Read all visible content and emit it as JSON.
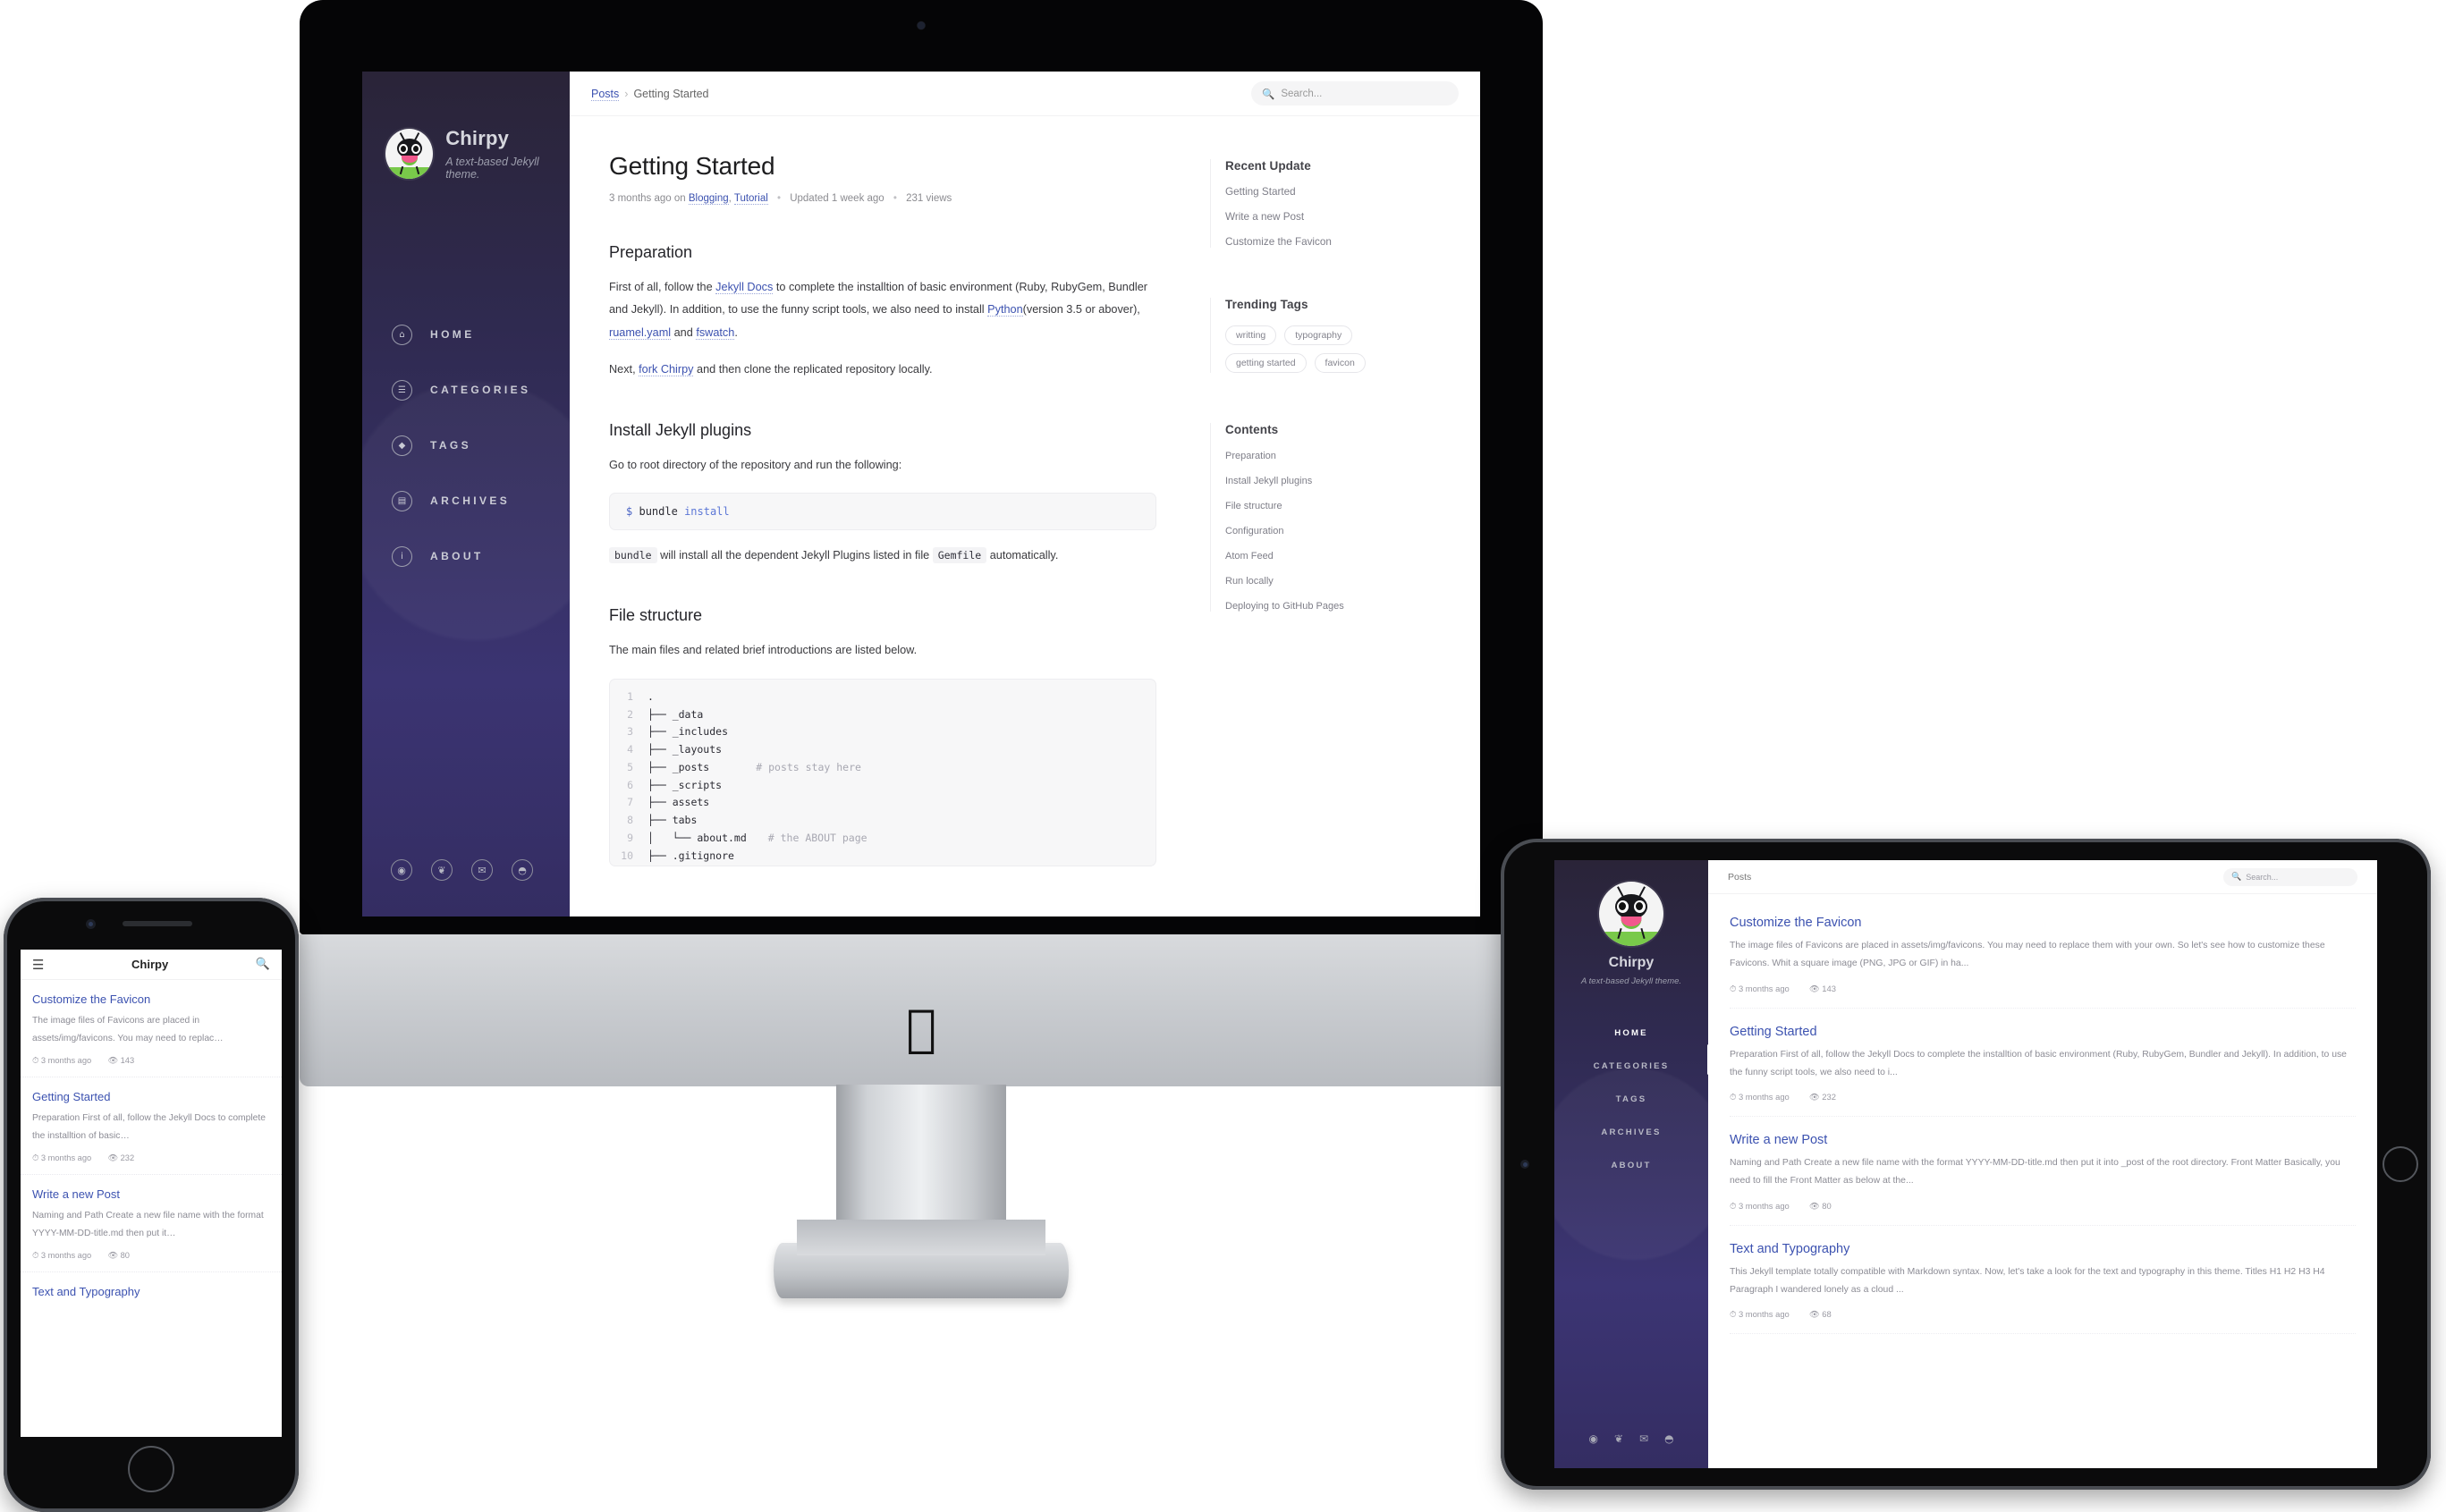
{
  "brand": {
    "name": "Chirpy",
    "tagline": "A text-based Jekyll theme.",
    "accent": "#3c52b0",
    "sidebar_color": "#332c62"
  },
  "desktop": {
    "breadcrumb": {
      "root": "Posts",
      "separator": "›",
      "current": "Getting Started"
    },
    "search": {
      "placeholder": "Search...",
      "icon": "search-icon"
    },
    "nav": [
      {
        "label": "HOME",
        "icon": "home-icon",
        "glyph": "⌂"
      },
      {
        "label": "CATEGORIES",
        "icon": "stream-icon",
        "glyph": "☰"
      },
      {
        "label": "TAGS",
        "icon": "tag-icon",
        "glyph": "◆"
      },
      {
        "label": "ARCHIVES",
        "icon": "archive-icon",
        "glyph": "▤"
      },
      {
        "label": "ABOUT",
        "icon": "info-icon",
        "glyph": "i"
      }
    ],
    "social": [
      {
        "name": "github-icon",
        "glyph": "●"
      },
      {
        "name": "twitter-icon",
        "glyph": "❦"
      },
      {
        "name": "email-icon",
        "glyph": "✉"
      },
      {
        "name": "rss-icon",
        "glyph": "◔"
      }
    ],
    "post": {
      "title": "Getting Started",
      "meta": {
        "published": "3 months ago on",
        "categories": [
          "Blogging",
          "Tutorial"
        ],
        "updated": "Updated 1 week ago",
        "views": "231 views"
      },
      "sections": {
        "preparation": {
          "heading": "Preparation",
          "p1_a": "First of all, follow the ",
          "p1_link1": "Jekyll Docs",
          "p1_b": " to complete the installtion of basic environment (Ruby, RubyGem, Bundler and Jekyll). In addition, to use the funny script tools, we also need to install ",
          "p1_link2": "Python",
          "p1_c": "(version 3.5 or abover), ",
          "p1_link3": "ruamel.yaml",
          "p1_d": " and ",
          "p1_link4": "fswatch",
          "p1_e": ".",
          "p2_a": "Next, ",
          "p2_link": "fork Chirpy",
          "p2_b": " and then clone the replicated repository locally."
        },
        "plugins": {
          "heading": "Install Jekyll plugins",
          "intro": "Go to root directory of the repository and run the following:",
          "code_prompt": "$",
          "code_cmd": "bundle",
          "code_arg": "install",
          "after_a": "bundle",
          "after_b": " will install all the dependent Jekyll Plugins listed in file ",
          "after_c": "Gemfile",
          "after_d": " automatically."
        },
        "filestructure": {
          "heading": "File structure",
          "intro": "The main files and related brief introductions are listed below.",
          "tree": [
            {
              "n": "1",
              "text": ".",
              "comment": ""
            },
            {
              "n": "2",
              "text": "├── _data",
              "comment": ""
            },
            {
              "n": "3",
              "text": "├── _includes",
              "comment": ""
            },
            {
              "n": "4",
              "text": "├── _layouts",
              "comment": ""
            },
            {
              "n": "5",
              "text": "├── _posts",
              "comment": "# posts stay here"
            },
            {
              "n": "6",
              "text": "├── _scripts",
              "comment": ""
            },
            {
              "n": "7",
              "text": "├── assets",
              "comment": ""
            },
            {
              "n": "8",
              "text": "├── tabs",
              "comment": ""
            },
            {
              "n": "9",
              "text": "│   └── about.md",
              "comment": "# the ABOUT page"
            },
            {
              "n": "10",
              "text": "├── .gitignore",
              "comment": ""
            }
          ]
        }
      }
    },
    "panels": {
      "recent_update": {
        "heading": "Recent Update",
        "items": [
          "Getting Started",
          "Write a new Post",
          "Customize the Favicon"
        ]
      },
      "trending_tags": {
        "heading": "Trending Tags",
        "tags": [
          "writting",
          "typography",
          "getting started",
          "favicon"
        ]
      },
      "contents": {
        "heading": "Contents",
        "items": [
          "Preparation",
          "Install Jekyll plugins",
          "File structure",
          "Configuration",
          "Atom Feed",
          "Run locally",
          "Deploying to GitHub Pages"
        ]
      }
    }
  },
  "phone": {
    "header": {
      "menu_icon": "hamburger-icon",
      "title": "Chirpy",
      "search_icon": "search-icon"
    },
    "posts": [
      {
        "title": "Customize the Favicon",
        "excerpt": "The image files of Favicons are placed in assets/img/favicons. You may need to replac…",
        "date": "3 months ago",
        "views": "143"
      },
      {
        "title": "Getting Started",
        "excerpt": "Preparation First of all, follow the Jekyll Docs to complete the installtion of basic…",
        "date": "3 months ago",
        "views": "232"
      },
      {
        "title": "Write a new Post",
        "excerpt": "Naming and Path Create a new file name with the format YYYY-MM-DD-title.md then put it…",
        "date": "3 months ago",
        "views": "80"
      },
      {
        "title": "Text and Typography",
        "excerpt": "",
        "date": "",
        "views": ""
      }
    ]
  },
  "tablet": {
    "breadcrumb": "Posts",
    "search": {
      "placeholder": "Search...",
      "icon": "search-icon"
    },
    "brand": {
      "name": "Chirpy",
      "tagline": "A text-based Jekyll theme."
    },
    "nav": [
      "HOME",
      "CATEGORIES",
      "TAGS",
      "ARCHIVES",
      "ABOUT"
    ],
    "active_nav": "HOME",
    "social": [
      {
        "name": "github-icon",
        "glyph": "●"
      },
      {
        "name": "twitter-icon",
        "glyph": "❦"
      },
      {
        "name": "email-icon",
        "glyph": "✉"
      },
      {
        "name": "rss-icon",
        "glyph": "◔"
      }
    ],
    "posts": [
      {
        "title": "Customize the Favicon",
        "excerpt": "The image files of Favicons are placed in assets/img/favicons. You may need to replace them with your own. So let's see how to customize these Favicons. Whit a square image (PNG, JPG or GIF) in ha...",
        "date": "3 months ago",
        "views": "143"
      },
      {
        "title": "Getting Started",
        "excerpt": "Preparation First of all, follow the Jekyll Docs to complete the installtion of basic environment (Ruby, RubyGem, Bundler and Jekyll). In addition, to use the funny script tools, we also need to i...",
        "date": "3 months ago",
        "views": "232"
      },
      {
        "title": "Write a new Post",
        "excerpt": "Naming and Path Create a new file name with the format YYYY-MM-DD-title.md then put it into _post of the root directory. Front Matter Basically, you need to fill the Front Matter as below at the...",
        "date": "3 months ago",
        "views": "80"
      },
      {
        "title": "Text and Typography",
        "excerpt": "This Jekyll template totally compatible with Markdown syntax. Now, let's take a look for the text and typography in this theme. Titles H1 H2 H3 H4 Paragraph I wandered lonely as a cloud ...",
        "date": "3 months ago",
        "views": "68"
      }
    ]
  },
  "devices": {
    "imac_logo": "apple-logo"
  }
}
